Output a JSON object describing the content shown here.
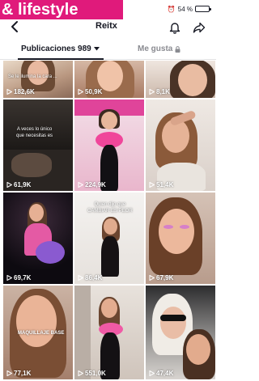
{
  "overlay": {
    "text": "& lifestyle"
  },
  "status": {
    "battery": "54 %",
    "battery_level": 0.54
  },
  "header": {
    "title": "Reitx"
  },
  "tabs": {
    "posts_label": "Publicaciones 989",
    "likes_label": "Me gusta"
  },
  "videos": [
    {
      "views": "182,6K",
      "caption": "Se le ilumina la cara ..."
    },
    {
      "views": "50,9K",
      "caption": ""
    },
    {
      "views": "8,1K",
      "caption": ""
    },
    {
      "views": "61,9K",
      "caption": "A veces lo único\nque necesitas es"
    },
    {
      "views": "224,9K",
      "caption": ""
    },
    {
      "views": "51,4K",
      "caption": ""
    },
    {
      "views": "69,7K",
      "caption": ""
    },
    {
      "views": "86,4K",
      "caption": "Quien dijo que\nCAMBIAR ES PEOR"
    },
    {
      "views": "67,9K",
      "caption": ""
    },
    {
      "views": "77,1K",
      "caption": "MAQUILLAJE BASE"
    },
    {
      "views": "551,0K",
      "caption": ""
    },
    {
      "views": "47,4K",
      "caption": ""
    }
  ]
}
